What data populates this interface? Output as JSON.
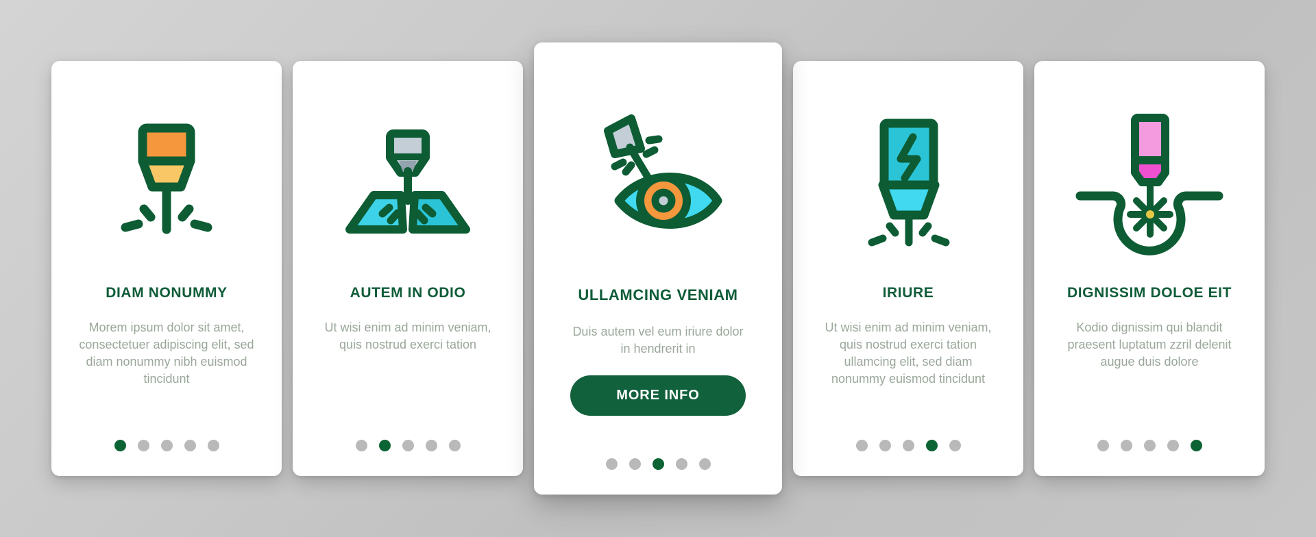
{
  "theme": {
    "brand_green": "#0f5c38",
    "dark_green_outline": "#0d5c34",
    "button_green": "#11613c",
    "body_text_gray": "#9aa79a",
    "dot_inactive": "#b9b9b9",
    "dot_active": "#0c6334",
    "card_background": "#ffffff",
    "page_background": "#c9c9c9",
    "accent_orange": "#f5973d",
    "accent_light_orange": "#f9c765",
    "accent_cyan": "#40d9f0",
    "accent_teal": "#2bc4d6",
    "accent_gray_blue": "#c3ced6",
    "accent_pink": "#f49be0",
    "accent_magenta": "#ef50cf",
    "accent_yellow": "#e6c846"
  },
  "cards": [
    {
      "id": "card-diam-nonummy",
      "icon_name": "laser-cutter-sparks-icon",
      "title": "DIAM NONUMMY",
      "body": "Morem ipsum dolor sit amet, consectetuer adipiscing elit, sed diam nonummy nibh euismod tincidunt",
      "dots": {
        "count": 5,
        "active_index": 0
      },
      "featured": false,
      "cta": null
    },
    {
      "id": "card-autem-in-odio",
      "icon_name": "laser-cutting-metal-sheet-icon",
      "title": "AUTEM IN ODIO",
      "body": "Ut wisi enim ad minim veniam, quis nostrud exerci tation",
      "dots": {
        "count": 5,
        "active_index": 1
      },
      "featured": false,
      "cta": null
    },
    {
      "id": "card-ullamcing-veniam",
      "icon_name": "laser-eye-surgery-icon",
      "title": "ULLAMCING VENIAM",
      "body": "Duis autem vel eum iriure dolor in hendrerit in",
      "dots": {
        "count": 5,
        "active_index": 2
      },
      "featured": true,
      "cta": "MORE INFO"
    },
    {
      "id": "card-iriure",
      "icon_name": "electric-laser-head-icon",
      "title": "IRIURE",
      "body": "Ut wisi enim ad minim veniam, quis nostrud exerci tation ullamcing elit, sed diam nonummy euismod tincidunt",
      "dots": {
        "count": 5,
        "active_index": 3
      },
      "featured": false,
      "cta": null
    },
    {
      "id": "card-dignissim-doloe-eit",
      "icon_name": "laser-engraving-surface-icon",
      "title": "DIGNISSIM DOLOE EIT",
      "body": "Kodio dignissim qui blandit praesent luptatum zzril delenit augue duis dolore",
      "dots": {
        "count": 5,
        "active_index": 4
      },
      "featured": false,
      "cta": null
    }
  ]
}
